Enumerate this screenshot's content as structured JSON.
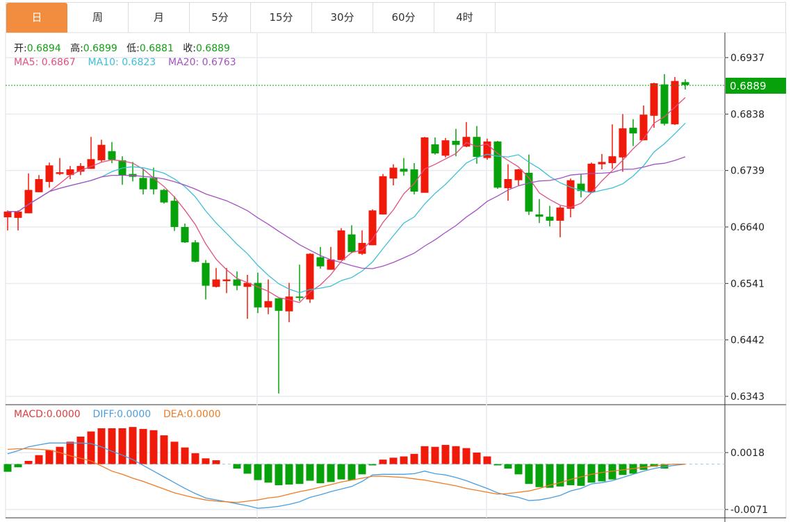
{
  "tabs": [
    {
      "label": "日",
      "active": true
    },
    {
      "label": "周",
      "active": false
    },
    {
      "label": "月",
      "active": false
    },
    {
      "label": "5分",
      "active": false
    },
    {
      "label": "15分",
      "active": false
    },
    {
      "label": "30分",
      "active": false
    },
    {
      "label": "60分",
      "active": false
    },
    {
      "label": "4时",
      "active": false
    }
  ],
  "legend": {
    "open_label": "开:",
    "open": "0.6894",
    "high_label": "高:",
    "high": "0.6899",
    "low_label": "低:",
    "low": "0.6881",
    "close_label": "收:",
    "close": "0.6889"
  },
  "ma_legend": [
    {
      "label": "MA5: ",
      "value": "0.6867"
    },
    {
      "label": "MA10: ",
      "value": "0.6823"
    },
    {
      "label": "MA20: ",
      "value": "0.6763"
    }
  ],
  "macd_legend": [
    {
      "label": "MACD:",
      "value": "0.0000"
    },
    {
      "label": "DIFF:",
      "value": "0.0000"
    },
    {
      "label": "DEA:",
      "value": "0.0000"
    }
  ],
  "current_price": "0.6889",
  "colors": {
    "up": "#f01a0a",
    "down": "#07a20b",
    "tab_active": "#f28c3f",
    "ma5": "#e05080",
    "ma10": "#3cc0d6",
    "ma20": "#a452c2",
    "diff": "#4a9ee0",
    "dea": "#f07a22",
    "grid": "#e6ebf0"
  },
  "chart_data": [
    {
      "type": "candlestick",
      "title": "",
      "y_ticks": [
        "0.6937",
        "0.6838",
        "0.6739",
        "0.6640",
        "0.6541",
        "0.6442",
        "0.6343"
      ],
      "ylim": [
        0.6343,
        0.6937
      ],
      "ma_periods": [
        5,
        10,
        20
      ],
      "ohlc": [
        [
          0.6657,
          0.6669,
          0.6634,
          0.6667
        ],
        [
          0.6656,
          0.6669,
          0.6634,
          0.6667
        ],
        [
          0.6664,
          0.6734,
          0.6664,
          0.6705
        ],
        [
          0.6701,
          0.6731,
          0.6701,
          0.6724
        ],
        [
          0.6719,
          0.6753,
          0.6709,
          0.6748
        ],
        [
          0.6733,
          0.6761,
          0.6731,
          0.6736
        ],
        [
          0.6731,
          0.6747,
          0.6724,
          0.6741
        ],
        [
          0.6737,
          0.6752,
          0.6731,
          0.6747
        ],
        [
          0.6742,
          0.6798,
          0.6742,
          0.6759
        ],
        [
          0.6757,
          0.6793,
          0.6754,
          0.6784
        ],
        [
          0.6773,
          0.6789,
          0.6752,
          0.6758
        ],
        [
          0.6757,
          0.6764,
          0.6714,
          0.6731
        ],
        [
          0.6733,
          0.6754,
          0.672,
          0.6728
        ],
        [
          0.6726,
          0.6741,
          0.6697,
          0.6706
        ],
        [
          0.6726,
          0.6744,
          0.6697,
          0.6706
        ],
        [
          0.6705,
          0.6707,
          0.6681,
          0.6683
        ],
        [
          0.6686,
          0.6694,
          0.6633,
          0.664
        ],
        [
          0.664,
          0.6646,
          0.6612,
          0.6613
        ],
        [
          0.6613,
          0.6617,
          0.6578,
          0.6579
        ],
        [
          0.6577,
          0.6582,
          0.6513,
          0.6537
        ],
        [
          0.6535,
          0.6568,
          0.6534,
          0.6548
        ],
        [
          0.6545,
          0.6568,
          0.6524,
          0.6548
        ],
        [
          0.6548,
          0.6562,
          0.6529,
          0.6537
        ],
        [
          0.6535,
          0.6556,
          0.6479,
          0.6542
        ],
        [
          0.6542,
          0.656,
          0.6489,
          0.6499
        ],
        [
          0.6499,
          0.6548,
          0.6487,
          0.651
        ],
        [
          0.6515,
          0.6515,
          0.6348,
          0.6493
        ],
        [
          0.6492,
          0.6542,
          0.6473,
          0.6518
        ],
        [
          0.6518,
          0.6574,
          0.651,
          0.6517
        ],
        [
          0.6513,
          0.6594,
          0.6507,
          0.6593
        ],
        [
          0.6587,
          0.6605,
          0.6567,
          0.6571
        ],
        [
          0.6565,
          0.6605,
          0.6565,
          0.6583
        ],
        [
          0.6582,
          0.6638,
          0.6582,
          0.6634
        ],
        [
          0.6627,
          0.6643,
          0.6594,
          0.6596
        ],
        [
          0.6593,
          0.6634,
          0.6591,
          0.6612
        ],
        [
          0.6608,
          0.6671,
          0.6608,
          0.6669
        ],
        [
          0.6662,
          0.6733,
          0.6662,
          0.6729
        ],
        [
          0.6725,
          0.675,
          0.6713,
          0.6744
        ],
        [
          0.6742,
          0.6761,
          0.673,
          0.6737
        ],
        [
          0.6741,
          0.6752,
          0.6697,
          0.6702
        ],
        [
          0.67,
          0.6798,
          0.67,
          0.6797
        ],
        [
          0.6785,
          0.6797,
          0.6767,
          0.6769
        ],
        [
          0.6765,
          0.6796,
          0.6762,
          0.6792
        ],
        [
          0.6791,
          0.6812,
          0.6764,
          0.6784
        ],
        [
          0.6781,
          0.6824,
          0.678,
          0.6798
        ],
        [
          0.6798,
          0.6817,
          0.6751,
          0.6763
        ],
        [
          0.6761,
          0.6795,
          0.6758,
          0.679
        ],
        [
          0.679,
          0.6791,
          0.6707,
          0.6709
        ],
        [
          0.6708,
          0.675,
          0.6686,
          0.6724
        ],
        [
          0.6722,
          0.6742,
          0.6713,
          0.6741
        ],
        [
          0.6735,
          0.6767,
          0.6661,
          0.6667
        ],
        [
          0.6662,
          0.6689,
          0.6647,
          0.6658
        ],
        [
          0.6658,
          0.6677,
          0.6641,
          0.6651
        ],
        [
          0.6651,
          0.6677,
          0.6622,
          0.6674
        ],
        [
          0.6672,
          0.6725,
          0.6657,
          0.6722
        ],
        [
          0.6716,
          0.6733,
          0.6692,
          0.6703
        ],
        [
          0.6701,
          0.6753,
          0.6701,
          0.6751
        ],
        [
          0.675,
          0.6768,
          0.6741,
          0.6754
        ],
        [
          0.6752,
          0.682,
          0.6742,
          0.6764
        ],
        [
          0.6762,
          0.6838,
          0.6737,
          0.6813
        ],
        [
          0.6814,
          0.6829,
          0.6782,
          0.6804
        ],
        [
          0.6792,
          0.6853,
          0.6792,
          0.6837
        ],
        [
          0.6835,
          0.6893,
          0.6814,
          0.6892
        ],
        [
          0.689,
          0.6908,
          0.6818,
          0.6821
        ],
        [
          0.682,
          0.6903,
          0.6819,
          0.6896
        ],
        [
          0.6894,
          0.6899,
          0.6881,
          0.6889
        ]
      ]
    },
    {
      "type": "bar+line",
      "title": "MACD",
      "y_ticks": [
        "0.0018",
        "-0.0071"
      ],
      "ylim": [
        -0.0071,
        0.0018
      ],
      "macd": [
        -0.0012,
        -0.0005,
        0.0005,
        0.0014,
        0.0022,
        0.0027,
        0.0035,
        0.0043,
        0.0051,
        0.0056,
        0.0056,
        0.0056,
        0.0058,
        0.0055,
        0.0053,
        0.0045,
        0.0035,
        0.0026,
        0.0017,
        0.0009,
        0.0006,
        0.0,
        -0.0007,
        -0.0015,
        -0.0025,
        -0.0029,
        -0.0033,
        -0.0032,
        -0.0031,
        -0.0026,
        -0.003,
        -0.0028,
        -0.0024,
        -0.0025,
        -0.0016,
        -0.0002,
        0.0007,
        0.001,
        0.0012,
        0.0016,
        0.0028,
        0.0027,
        0.003,
        0.0028,
        0.0025,
        0.0018,
        0.0012,
        -0.0002,
        -0.0007,
        -0.0016,
        -0.0031,
        -0.0036,
        -0.0037,
        -0.0035,
        -0.0033,
        -0.0034,
        -0.0029,
        -0.0027,
        -0.0024,
        -0.0017,
        -0.0015,
        -0.0009,
        -0.0004,
        -0.0007,
        0.0,
        0.0
      ],
      "diff": [
        0.0016,
        0.0021,
        0.0027,
        0.003,
        0.0033,
        0.0033,
        0.0033,
        0.0033,
        0.0032,
        0.0027,
        0.002,
        0.0014,
        0.0007,
        -0.0002,
        -0.0011,
        -0.002,
        -0.0029,
        -0.0038,
        -0.0046,
        -0.0053,
        -0.0056,
        -0.0059,
        -0.0062,
        -0.0065,
        -0.0069,
        -0.0068,
        -0.0066,
        -0.0063,
        -0.0059,
        -0.0052,
        -0.0048,
        -0.0043,
        -0.0039,
        -0.0035,
        -0.0027,
        -0.0017,
        -0.0016,
        -0.0016,
        -0.0016,
        -0.0015,
        -0.0011,
        -0.0015,
        -0.0017,
        -0.0021,
        -0.0026,
        -0.0032,
        -0.0038,
        -0.0045,
        -0.0049,
        -0.0052,
        -0.0057,
        -0.0056,
        -0.0053,
        -0.0049,
        -0.0042,
        -0.0038,
        -0.0031,
        -0.0029,
        -0.0026,
        -0.0021,
        -0.0016,
        -0.0011,
        -0.0007,
        -0.0004,
        -0.0002,
        0.0
      ],
      "dea": [
        0.0023,
        0.0024,
        0.0024,
        0.0023,
        0.0022,
        0.0018,
        0.0013,
        0.0009,
        0.0005,
        -0.0003,
        -0.0011,
        -0.0016,
        -0.0022,
        -0.0027,
        -0.0033,
        -0.0039,
        -0.0045,
        -0.0049,
        -0.0053,
        -0.0056,
        -0.0058,
        -0.0059,
        -0.006,
        -0.0058,
        -0.0056,
        -0.0053,
        -0.0051,
        -0.0047,
        -0.0043,
        -0.004,
        -0.0036,
        -0.0032,
        -0.0028,
        -0.0025,
        -0.0022,
        -0.0019,
        -0.0019,
        -0.002,
        -0.0021,
        -0.0023,
        -0.0025,
        -0.0028,
        -0.0031,
        -0.0034,
        -0.0038,
        -0.0041,
        -0.0044,
        -0.0047,
        -0.0046,
        -0.0044,
        -0.0042,
        -0.0038,
        -0.0033,
        -0.0029,
        -0.0024,
        -0.002,
        -0.0016,
        -0.0013,
        -0.0011,
        -0.0009,
        -0.0007,
        -0.0005,
        -0.0003,
        -0.0001,
        0.0,
        0.0
      ]
    }
  ]
}
